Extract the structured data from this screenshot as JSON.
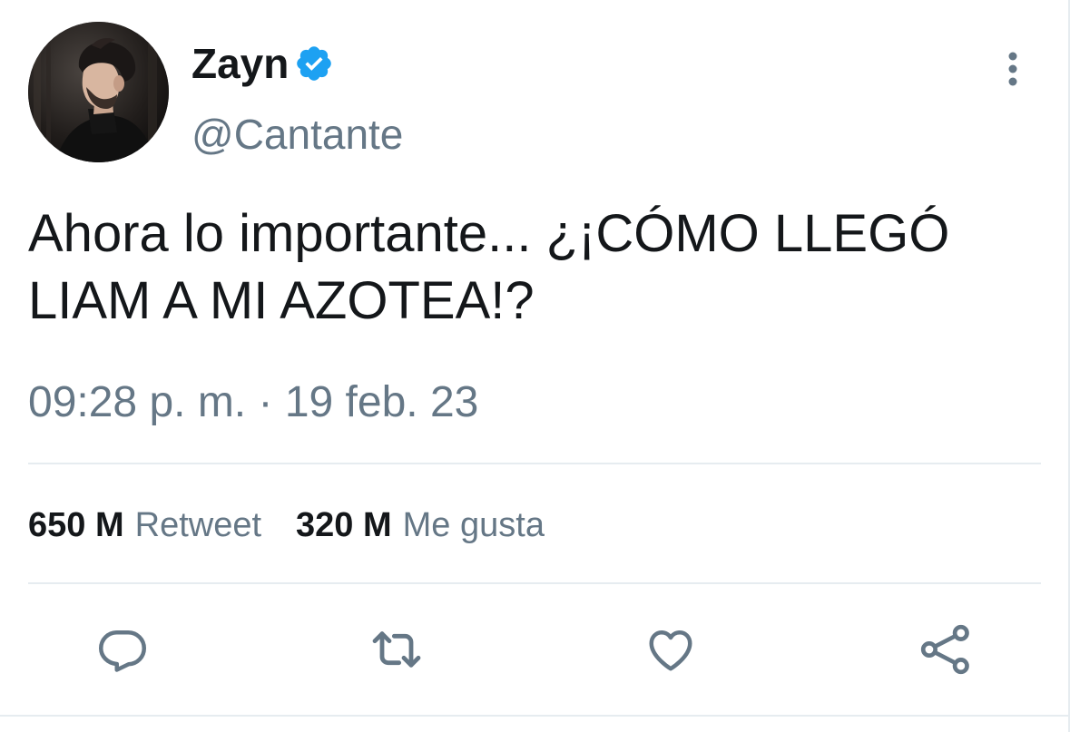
{
  "tweet": {
    "author": {
      "display_name": "Zayn",
      "handle": "@Cantante",
      "verified": true,
      "avatar_icon": "profile-photo"
    },
    "text": "Ahora lo importante... ¿¡CÓMO LLEGÓ LIAM A MI AZOTEA!?",
    "time": "09:28 p. m.",
    "separator": "·",
    "date": "19 feb. 23",
    "stats": [
      {
        "count": "650 M",
        "label": "Retweet"
      },
      {
        "count": "320 M",
        "label": "Me gusta"
      }
    ],
    "actions": [
      "reply-icon",
      "retweet-icon",
      "like-icon",
      "share-icon"
    ],
    "more_icon": "more-vertical-icon"
  },
  "colors": {
    "text_primary": "#14171a",
    "text_secondary": "#657786",
    "verified_blue": "#1da1f2",
    "divider": "#e6ecf0"
  }
}
